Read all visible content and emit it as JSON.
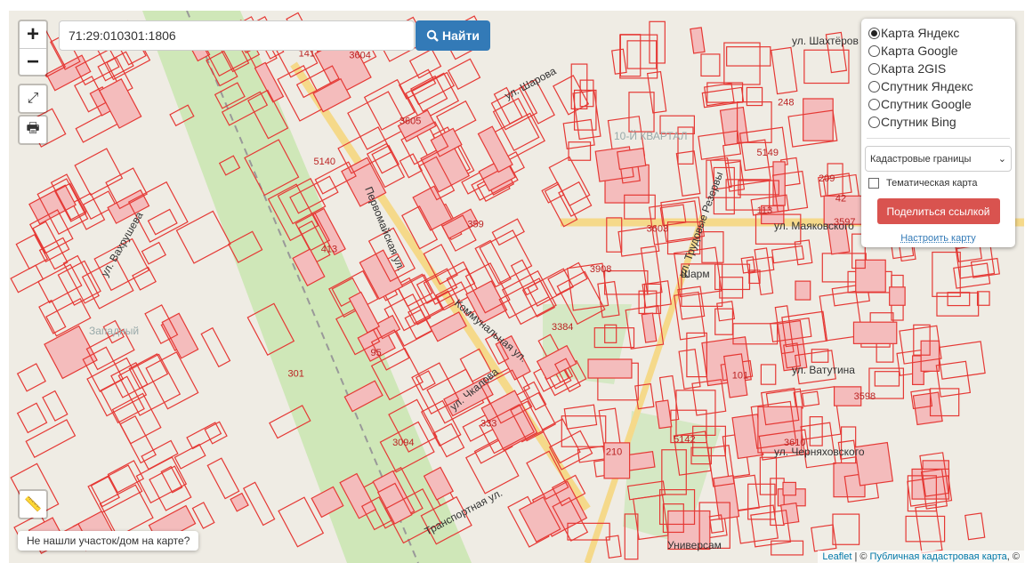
{
  "search": {
    "value": "71:29:010301:1806",
    "button_label": "Найти"
  },
  "controls": {
    "zoom_in": "+",
    "zoom_out": "−",
    "fullscreen": "⤢",
    "print": "🖶",
    "ruler": "📏"
  },
  "layers": {
    "options": [
      {
        "label": "Карта Яндекс",
        "selected": true
      },
      {
        "label": "Карта Google",
        "selected": false
      },
      {
        "label": "Карта 2GIS",
        "selected": false
      },
      {
        "label": "Спутник Яндекс",
        "selected": false
      },
      {
        "label": "Спутник Google",
        "selected": false
      },
      {
        "label": "Спутник Bing",
        "selected": false
      }
    ],
    "overlay_select": "Кадастровые границы",
    "thematic_label": "Тематическая карта",
    "thematic_checked": false,
    "share_label": "Поделиться ссылкой",
    "configure_label": "Настроить карту"
  },
  "not_found_label": "Не нашли участок/дом на карте?",
  "attribution": {
    "leaflet": "Leaflet",
    "sep": " | © ",
    "source": "Публичная кадастровая карта",
    "tail": ", ©"
  },
  "map_labels": {
    "streets": [
      "ул. Шахтёров",
      "ул. Маяковского",
      "ул. Ватутина",
      "ул. Черняховского",
      "Первомайская ул.",
      "ул. Шарова",
      "Транспортная ул.",
      "ул. Трудовые Резервы",
      "Коммунальная ул.",
      "ул. Чкалова",
      "ул. Вахрушева",
      "Западный",
      "10-Й КВАРТАЛ",
      "Шарм",
      "Универсам"
    ],
    "parcels": [
      "3384",
      "3603",
      "3597",
      "3604",
      "3605",
      "95",
      "3610",
      "3598",
      "333",
      "5140",
      "359",
      "248",
      "301",
      "3908",
      "141",
      "413",
      "42",
      "3094",
      "210",
      "209",
      "5142",
      "5149",
      "101",
      "113"
    ]
  },
  "colors": {
    "accent": "#337ab7",
    "danger": "#d9534f",
    "parcel": "#e53935",
    "map_bg": "#efece4"
  }
}
